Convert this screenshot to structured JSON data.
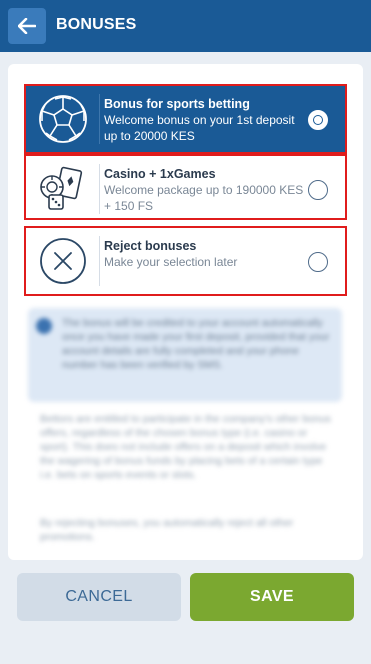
{
  "header": {
    "title": "BONUSES",
    "back_icon": "arrow-left-icon"
  },
  "options": [
    {
      "title": "Bonus for sports betting",
      "subtitle": "Welcome bonus on your 1st deposit up to 20000 KES",
      "icon": "soccer-ball-icon",
      "selected": true
    },
    {
      "title": "Casino + 1xGames",
      "subtitle": "Welcome package up to 190000 KES + 150 FS",
      "icon": "casino-cards-dice-icon",
      "selected": false
    },
    {
      "title": "Reject bonuses",
      "subtitle": "Make your selection later",
      "icon": "close-circle-icon",
      "selected": false
    }
  ],
  "info": {
    "text": "The bonus will be credited to your account automatically once you have made your first deposit, provided that your account details are fully completed and your phone number has been verified by SMS."
  },
  "notes": [
    "Bettors are entitled to participate in the company's other bonus offers, regardless of the chosen bonus type (i.e. casino or sport). This does not include offers on a deposit which involve the wagering of bonus funds by placing bets of a certain type i.e. bets on sports events or slots.",
    "By rejecting bonuses, you automatically reject all other promotions."
  ],
  "footer": {
    "cancel_label": "CANCEL",
    "save_label": "SAVE"
  },
  "colors": {
    "header": "#1a5a96",
    "selected": "#1a5a96",
    "highlight_outline": "#e01c1c",
    "save": "#7ba830",
    "cancel": "#d2dce7"
  }
}
